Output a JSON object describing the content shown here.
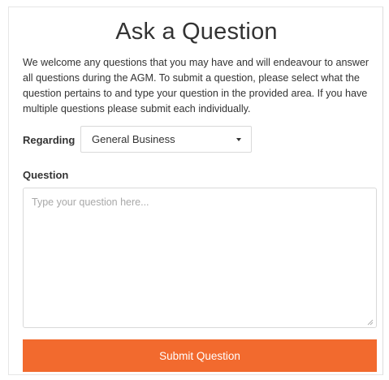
{
  "form": {
    "title": "Ask a Question",
    "intro": "We welcome any questions that you may have and will endeavour to answer all questions during the AGM. To submit a question, please select what the question pertains to and type your question in the provided area. If you have multiple questions please submit each individually.",
    "regarding": {
      "label": "Regarding",
      "selected": "General Business",
      "icon": "chevron-down-icon"
    },
    "question": {
      "label": "Question",
      "value": "",
      "placeholder": "Type your question here..."
    },
    "submit_label": "Submit Question"
  },
  "colors": {
    "accent": "#f26a2e",
    "border": "#d9d9d9",
    "text": "#333333",
    "placeholder": "#a8a8a8"
  }
}
